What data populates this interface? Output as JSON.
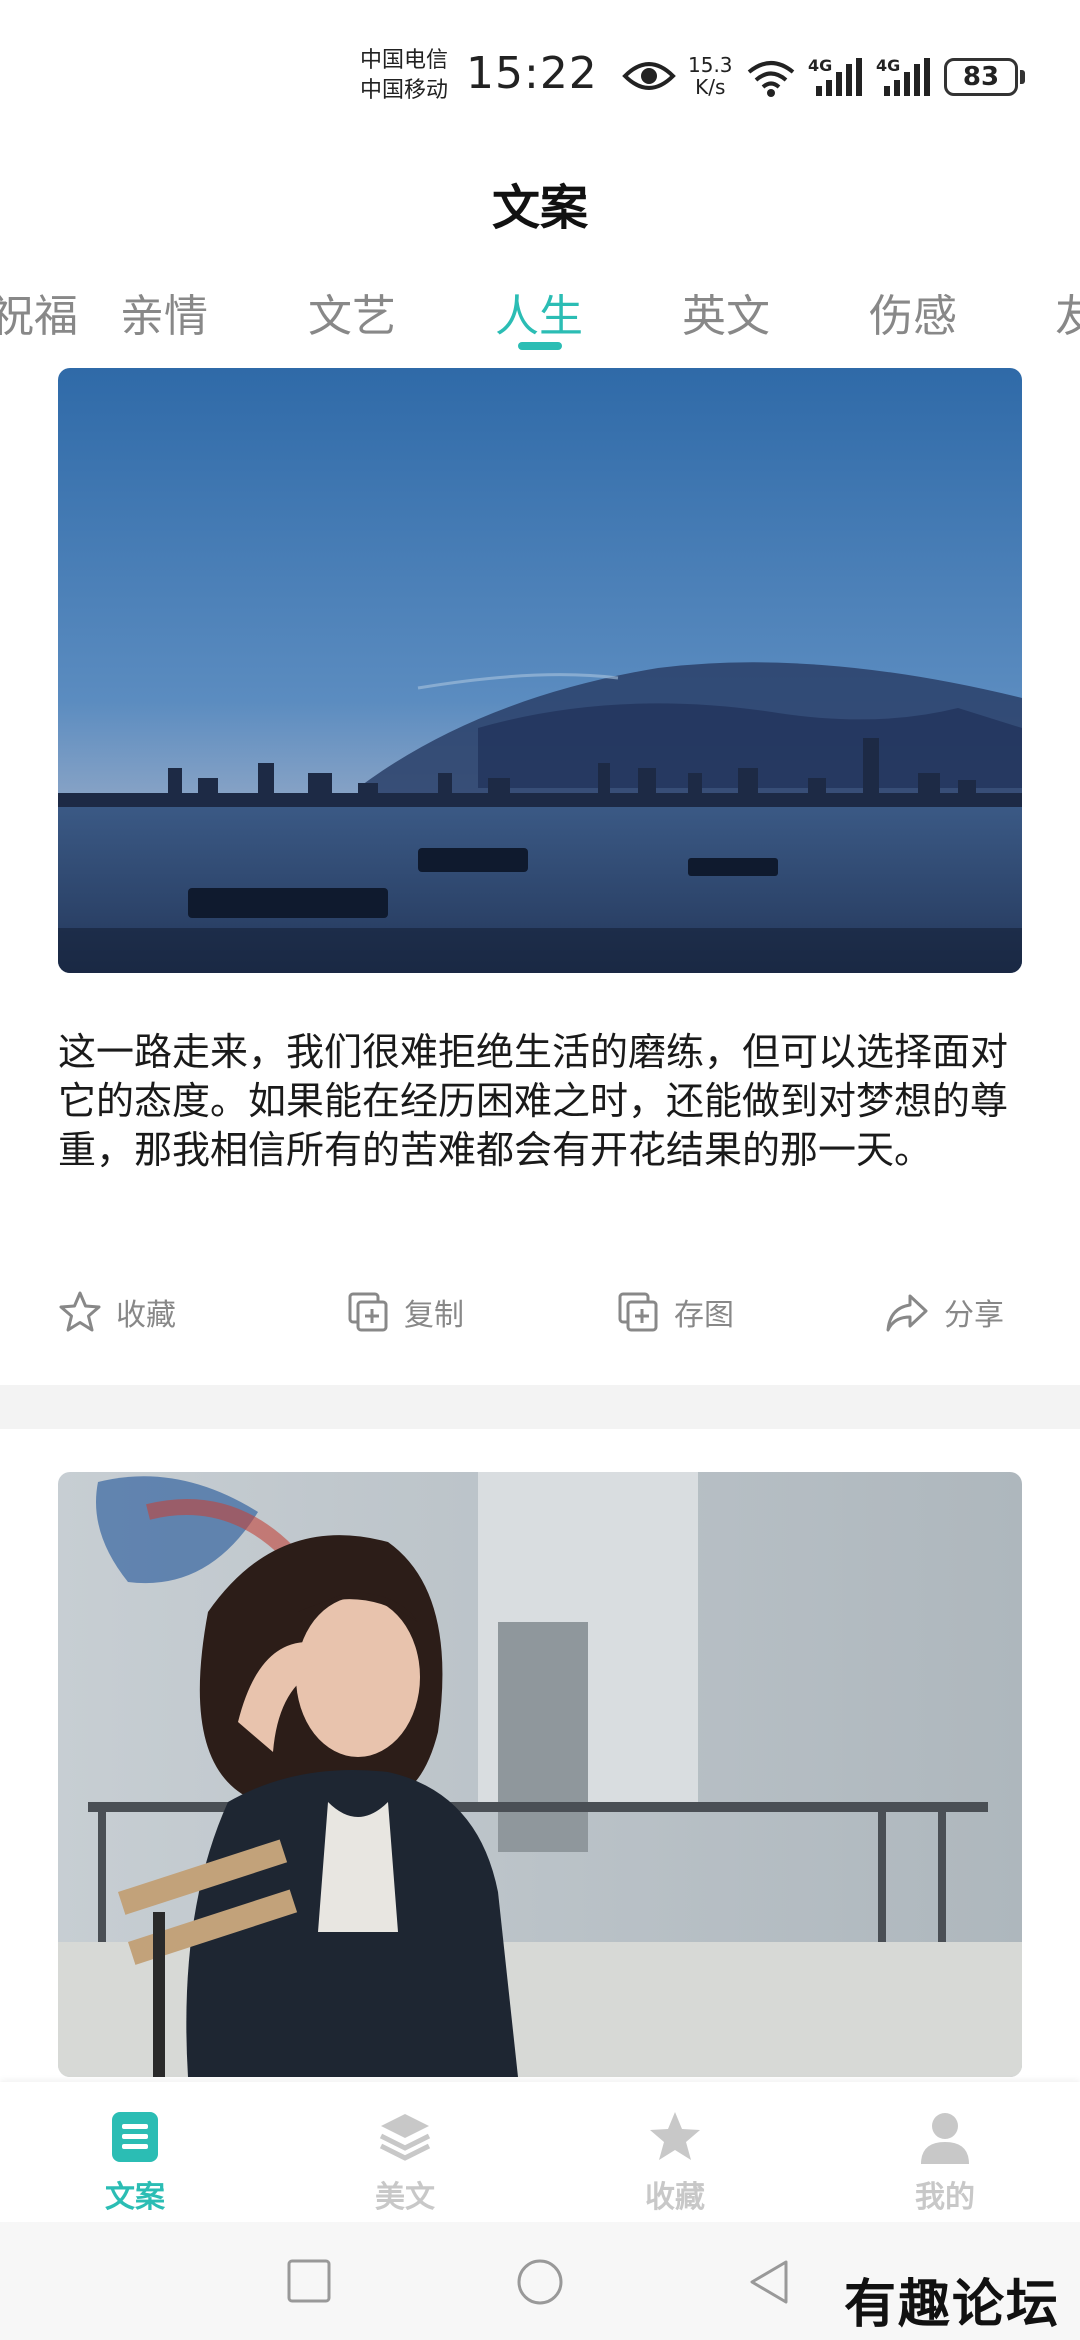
{
  "status_bar": {
    "carrier_1": "中国电信",
    "carrier_2": "中国移动",
    "time": "15:22",
    "net_speed_value": "15.3",
    "net_speed_unit": "K/s",
    "signal_1": "4G",
    "signal_2": "4G",
    "battery": "83"
  },
  "header": {
    "title": "文案"
  },
  "tabs": [
    {
      "label": "祝福",
      "active": false
    },
    {
      "label": "亲情",
      "active": false
    },
    {
      "label": "文艺",
      "active": false
    },
    {
      "label": "人生",
      "active": true
    },
    {
      "label": "英文",
      "active": false
    },
    {
      "label": "伤感",
      "active": false
    },
    {
      "label": "友",
      "active": false
    }
  ],
  "cards": [
    {
      "text": "这一路走来，我们很难拒绝生活的磨练，但可以选择面对它的态度。如果能在经历困难之时，还能做到对梦想的尊重，那我相信所有的苦难都会有开花结果的那一天。",
      "actions": {
        "favorite": "收藏",
        "copy": "复制",
        "save_image": "存图",
        "share": "分享"
      }
    }
  ],
  "bottom_nav": [
    {
      "label": "文案",
      "active": true
    },
    {
      "label": "美文",
      "active": false
    },
    {
      "label": "收藏",
      "active": false
    },
    {
      "label": "我的",
      "active": false
    }
  ],
  "watermark": "有趣论坛",
  "colors": {
    "accent": "#2bbdb4",
    "inactive": "#c8c8c8",
    "muted_text": "#888888"
  }
}
